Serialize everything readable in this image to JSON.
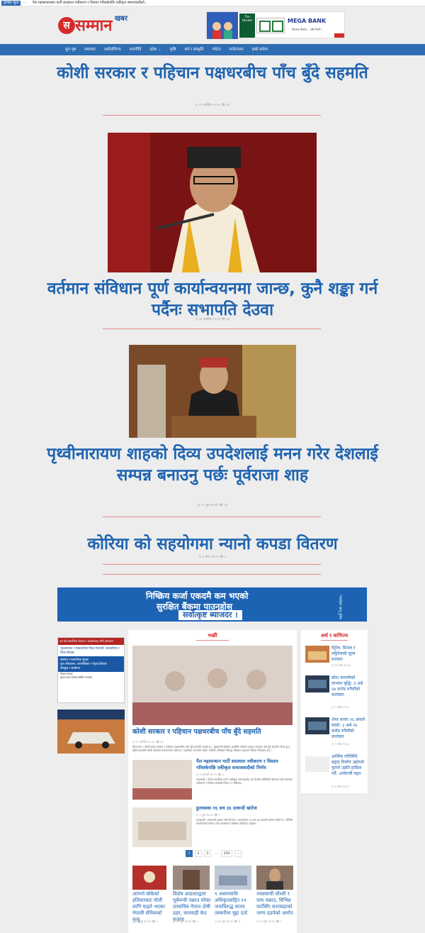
{
  "ticker": {
    "label": "ट्रेन्डिङ न्युज",
    "arrow": "‹ ›",
    "text": "पैल महासन्धानका पार्टी सदस्यता नवीकरण र विस्तार गरिसकेपछि एकीकृत समाजवादीलो..."
  },
  "site": {
    "logo_mark": "स",
    "name": "सम्मान",
    "sub": "खबर"
  },
  "ad_top": {
    "badge": "The Hucket",
    "bank": "MEGA BANK",
    "slogan": "विश्वास बैंकमा... सधैं मेगामै..."
  },
  "nav": [
    "मूल पृष्ठ",
    "समाचार",
    "अर्थवाणिज्य",
    "राजनीति",
    "प्रदेश ⌄",
    "कृषि",
    "धर्म र संस्कृति",
    "पर्यटन",
    "मनोरञ्जन",
    "हाम्रो बारेमा"
  ],
  "articles": [
    {
      "title": "कोशी सरकार र पहिचान पक्षधरबीच पाँच बुँदे सहमति",
      "meta": "◷ २२ कार्तिक १८:४८   👁 ३५"
    },
    {
      "title": "वर्तमान संविधान पूर्ण कार्यान्वयनमा जान्छ, कुनै शङ्का गर्न पर्दैनः सभापति देउवा",
      "meta": "◷ २६ कार्तिक १५:२५   👁 ३६"
    },
    {
      "title": "पृथ्वीनारायण शाहको दिव्य उपदेशलाई मनन गरेर देशलाई सम्पन्न बनाउनु पर्छः पूर्वराजा शाह",
      "meta": "◷ २८ पुस १४:३२   👁 ३६"
    },
    {
      "title": "कोरिया को सहयोगमा न्यानो कपडा वितरण",
      "meta": "◷ ३ माघ ११:५१   👁 ३"
    }
  ],
  "wide_ad": {
    "l1": "निष्क्रिय कर्जा एकदमै कम भएको",
    "l2": "सुरक्षित बैंकमा पाउनुहोस्",
    "l3": "सर्वोत्कृष्ट ब्याजदर ।",
    "l4": "*सर्तहरू लागू हुनेछ"
  },
  "side_ad": {
    "top": "दश वर्षे सामाजिक सेवाका र कार्यक्रमका लागि प्रस्तावना",
    "q": "'सुशासनका र स्वास्थ्यकिय गिक्षा रोजगारी, जलजलिया र जिया विकास",
    "l1": "स्वास्थ्य र सामाजिक सुरक्षा",
    "l2": "युवा परिचालन, जनजीविका र नेतृत्व विकास",
    "l3": "सेलफुड र सम्बोधन",
    "bot": "नेपाल सरकार\nसूचना तथा सञ्चार प्रविधि मन्त्रालय"
  },
  "mid": {
    "heading": "भर्खरै",
    "feature_title": "कोशी सरकार र पहिचान पक्षधरबीच पाँच बुँदे सहमति",
    "feature_meta": "◷ २२ कार्तिक १८:४८   👁 ३४",
    "feature_excerpt": "विराटनगर । कोशी प्रदेश सरकार र पहिचान पक्षधरबीच पाँच बुँदे सहमति भएको छ । मुख्यमन्त्री हिक्मत कार्कीले पहिचान पक्षधर लगायत पाँच बुँदे सहमति गरेका हुन् । पहिचानवादीले कोशी प्रदेशको नामकरणमा पहिचान र कोशीका सन्दर्भमा संघमा पार्टीको अधिवेशन विरुद्ध पहिचान पक्षधरले विरोध गरिरहेका छन् ।",
    "items": [
      {
        "title": "पैल महासन्धान पार्टी सदस्यता नवीकरण र विस्तार गरिसकेपछि एकीकृत समाजवादीको निर्णय",
        "meta": "◷ १ जनवरी ११:२५   👁 ३",
        "excerpt": "काठमाडौं । नेपाल कम्युनिष्ट पार्टी (एकीकृत समाजवादी) को केन्द्रीय समितिको बैठकले पार्टी सदस्यता नवीकरण र विस्तार सम्बन्धी निर्णय ११ डिसेम्बर..."
      },
      {
        "title": "हुलाकका १६ सय ३६ दरबन्दी खारेज",
        "meta": "◷ ८ पुस १४:२२   👁 २",
        "excerpt": "काठमाडौं । सरकारले हुलाक सेवा विभाग र अन्तर्गतका १६ सय ३६ दरबन्दी खारेज गरेको छ । विभिन्न कार्यालयको संगठन तथा व्यवस्थापन सर्वेक्षण प्रतिवेदन अनुसार..."
      }
    ],
    "pages": [
      "1",
      "2",
      "3",
      "...",
      "259",
      "›"
    ]
  },
  "right": {
    "heading": "अर्थ र वाणिज्य",
    "items": [
      {
        "title": "पेट्रोल, डिजल र मट्टितेलको मूल्य यथावत",
        "meta": "◷ १९ भाद्र ११:३५"
      },
      {
        "title": "छोटा कम्पनीको लाभांश बृद्धि: ३ अर्ब ६७ करोड रुपैयाँको कारोबार",
        "meta": "◷ ५ भाद्र १२:३०"
      },
      {
        "title": "शेयर बजार २६ अंकले घट्यो: ३ अर्ब २४ करोड रुपैयाँको कारोबार",
        "meta": "◷ ५ भाद्र १२:३०"
      },
      {
        "title": "आर्थिक गतिविधि बढ्दा निर्माण उद्योगले पुरानो उन्नति हासिल गर्दै: अर्थमन्त्री महत",
        "meta": "◷ १ माघ ११:१२"
      }
    ]
  },
  "bottom": [
    {
      "title": "आफ्नो बोकेको हतियारबाट गोली लागि घाइते भएका नेपाली सेनिकको मृत्यु",
      "meta": "◷ ११ पुस १४:१९   👁 २"
    },
    {
      "title": "विशेष अदालतद्वारा पूर्वमन्त्री पक्राउ परेका उपसचिव नेपाल दोषी ठहर, कारवाही केद सजाय",
      "meta": "◷ ११ पुस १४:१९   👁 ४"
    },
    {
      "title": "९ असारमाथि अधिकृतसहित २२ जनाविरुद्ध मानव तस्करीमा मुद्दा दर्ता",
      "meta": "◷ ११ पुस १४:१९   👁 ३"
    },
    {
      "title": "ज्ववसायी चौधरी र पाथ पक्राउ, विभिन्न पार्टीसँग कारवाहाको जग्गा हडपेको आरोप",
      "meta": "◷ ११ पुस १४:१९   👁 ३"
    }
  ]
}
